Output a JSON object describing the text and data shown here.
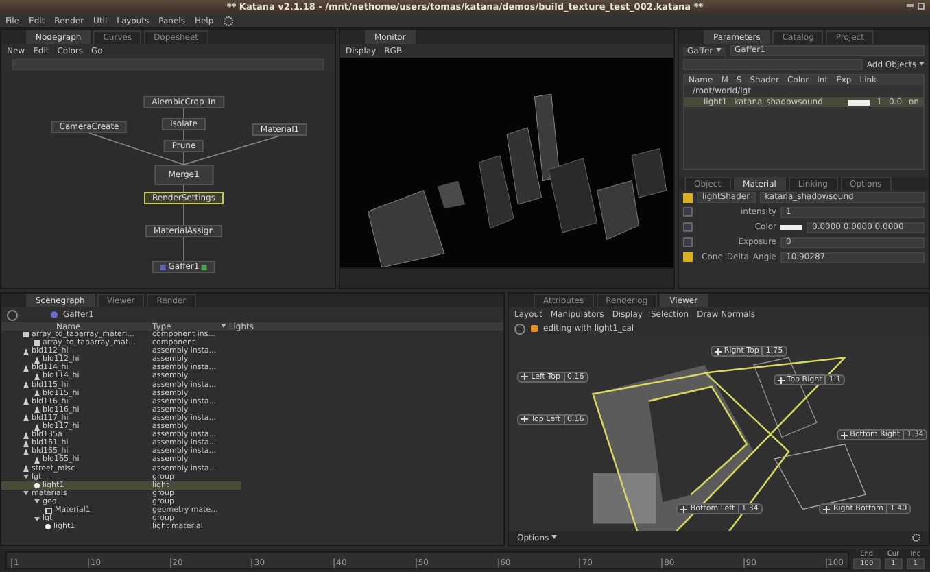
{
  "window": {
    "title": "** Katana v2.1.18 - /mnt/nethome/users/tomas/katana/demos/build_texture_test_002.katana **"
  },
  "menu": [
    "File",
    "Edit",
    "Render",
    "Util",
    "Layouts",
    "Panels",
    "Help"
  ],
  "nodegraph": {
    "tabs": [
      {
        "label": "Nodegraph",
        "selected": true
      },
      {
        "label": "Curves",
        "selected": false
      },
      {
        "label": "Dopesheet",
        "selected": false
      }
    ],
    "menu": [
      "New",
      "Edit",
      "Colors",
      "Go"
    ],
    "nodes": [
      {
        "label": "AlembicCrop_In",
        "selected": false,
        "kind": "plain"
      },
      {
        "label": "Isolate",
        "selected": false,
        "kind": "plain"
      },
      {
        "label": "Prune",
        "selected": false,
        "kind": "plain"
      },
      {
        "label": "Merge1",
        "selected": false,
        "kind": "merge"
      },
      {
        "label": "CameraCreate",
        "selected": false,
        "kind": "plain"
      },
      {
        "label": "Material1",
        "selected": false,
        "kind": "plain"
      },
      {
        "label": "RenderSettings",
        "selected": true,
        "kind": "plain"
      },
      {
        "label": "MaterialAssign",
        "selected": false,
        "kind": "plain"
      },
      {
        "label": "Gaffer1",
        "selected": false,
        "kind": "gaffer"
      }
    ]
  },
  "monitor": {
    "tabs": [
      {
        "label": "Monitor",
        "selected": true
      }
    ],
    "toolbar": [
      "Display",
      "RGB"
    ]
  },
  "parameters": {
    "tabs": [
      {
        "label": "Parameters",
        "selected": true
      },
      {
        "label": "Catalog",
        "selected": false
      },
      {
        "label": "Project",
        "selected": false
      }
    ],
    "node_type": "Gaffer",
    "node_name": "Gaffer1",
    "add_button": "Add Objects",
    "columns": [
      "Name",
      "M",
      "S",
      "Shader",
      "Color",
      "Int",
      "Exp",
      "Link"
    ],
    "group": "/root/world/lgt",
    "light": {
      "name": "light1",
      "shader": "katana_shadowsound",
      "int": "1",
      "exp": "0.0",
      "link": "on"
    },
    "subtabs": [
      {
        "label": "Object",
        "selected": false
      },
      {
        "label": "Material",
        "selected": true
      },
      {
        "label": "Linking",
        "selected": false
      },
      {
        "label": "Options",
        "selected": false
      }
    ],
    "shader_label": "lightShader",
    "shader_value": "katana_shadowsound",
    "params": [
      {
        "label": "intensity",
        "value": "1",
        "set": false,
        "kind": "text"
      },
      {
        "label": "Color",
        "value": "0.0000  0.0000  0.0000",
        "set": false,
        "kind": "color"
      },
      {
        "label": "Exposure",
        "value": "0",
        "set": false,
        "kind": "text"
      },
      {
        "label": "Cone_Delta_Angle",
        "value": "10.90287",
        "set": true,
        "kind": "text"
      }
    ]
  },
  "scenegraph": {
    "tabs": [
      {
        "label": "Scenegraph",
        "selected": true
      },
      {
        "label": "Viewer",
        "selected": false
      },
      {
        "label": "Render",
        "selected": false
      }
    ],
    "root": "Gaffer1",
    "columns": [
      "Name",
      "Type",
      "Lights"
    ],
    "rows": [
      {
        "name": "array_to_tabarray_materi...",
        "type": "component ins...",
        "kind": "component",
        "selected": false,
        "children": [
          {
            "name": "array_to_tabarray_mat...",
            "type": "component",
            "kind": "component",
            "selected": false
          }
        ]
      },
      {
        "name": "bld112_hi",
        "type": "assembly insta...",
        "kind": "assembly",
        "selected": false,
        "children": [
          {
            "name": "bld112_hi",
            "type": "assembly",
            "kind": "assembly",
            "selected": false
          }
        ]
      },
      {
        "name": "bld114_hi",
        "type": "assembly insta...",
        "kind": "assembly",
        "selected": false,
        "children": [
          {
            "name": "bld114_hi",
            "type": "assembly",
            "kind": "assembly",
            "selected": false
          }
        ]
      },
      {
        "name": "bld115_hi",
        "type": "assembly insta...",
        "kind": "assembly",
        "selected": false,
        "children": [
          {
            "name": "bld115_hi",
            "type": "assembly",
            "kind": "assembly",
            "selected": false
          }
        ]
      },
      {
        "name": "bld116_hi",
        "type": "assembly insta...",
        "kind": "assembly",
        "selected": false,
        "children": [
          {
            "name": "bld116_hi",
            "type": "assembly",
            "kind": "assembly",
            "selected": false
          }
        ]
      },
      {
        "name": "bld117_hi",
        "type": "assembly insta...",
        "kind": "assembly",
        "selected": false,
        "children": [
          {
            "name": "bld117_hi",
            "type": "assembly",
            "kind": "assembly",
            "selected": false
          }
        ]
      },
      {
        "name": "bld135a",
        "type": "assembly insta...",
        "kind": "assembly",
        "selected": false
      },
      {
        "name": "bld161_hi",
        "type": "assembly insta...",
        "kind": "assembly",
        "selected": false
      },
      {
        "name": "bld165_hi",
        "type": "assembly insta...",
        "kind": "assembly",
        "selected": false,
        "children": [
          {
            "name": "bld165_hi",
            "type": "assembly",
            "kind": "assembly",
            "selected": false
          }
        ]
      },
      {
        "name": "street_misc",
        "type": "assembly insta...",
        "kind": "assembly",
        "selected": false
      },
      {
        "name": "lgt",
        "type": "group",
        "kind": "group",
        "selected": false,
        "children": [
          {
            "name": "light1",
            "type": "light",
            "kind": "light",
            "selected": true
          }
        ]
      },
      {
        "name": "materials",
        "type": "group",
        "kind": "group",
        "selected": false,
        "children": [
          {
            "name": "geo",
            "type": "group",
            "kind": "group",
            "selected": false,
            "children": [
              {
                "name": "Material1",
                "type": "geometry mate...",
                "kind": "material",
                "selected": false
              }
            ]
          },
          {
            "name": "lgt",
            "type": "group",
            "kind": "group",
            "selected": false,
            "children": [
              {
                "name": "light1",
                "type": "light material",
                "kind": "light",
                "selected": false
              }
            ]
          }
        ]
      }
    ]
  },
  "viewer": {
    "tabs": [
      {
        "label": "Attributes",
        "selected": false
      },
      {
        "label": "Renderlog",
        "selected": false
      },
      {
        "label": "Viewer",
        "selected": true
      }
    ],
    "menu": [
      "Layout",
      "Manipulators",
      "Display",
      "Selection",
      "Draw Normals"
    ],
    "editing": "editing with light1_cal",
    "handles": [
      {
        "label": "Left Top",
        "value": "0.16"
      },
      {
        "label": "Top Left",
        "value": "0.16"
      },
      {
        "label": "Right Top",
        "value": "1.75"
      },
      {
        "label": "Top Right",
        "value": "1.1"
      },
      {
        "label": "Bottom Right",
        "value": "1.34"
      },
      {
        "label": "Bottom Left",
        "value": "1.34"
      },
      {
        "label": "Right Bottom",
        "value": "1.40"
      }
    ],
    "options": "Options"
  },
  "timeline": {
    "ticks": [
      "1",
      "10",
      "20",
      "30",
      "40",
      "50",
      "60",
      "70",
      "80",
      "90",
      "100"
    ],
    "fields": [
      {
        "label": "End",
        "value": "100"
      },
      {
        "label": "Cur",
        "value": "1"
      },
      {
        "label": "Inc",
        "value": "1"
      }
    ]
  }
}
